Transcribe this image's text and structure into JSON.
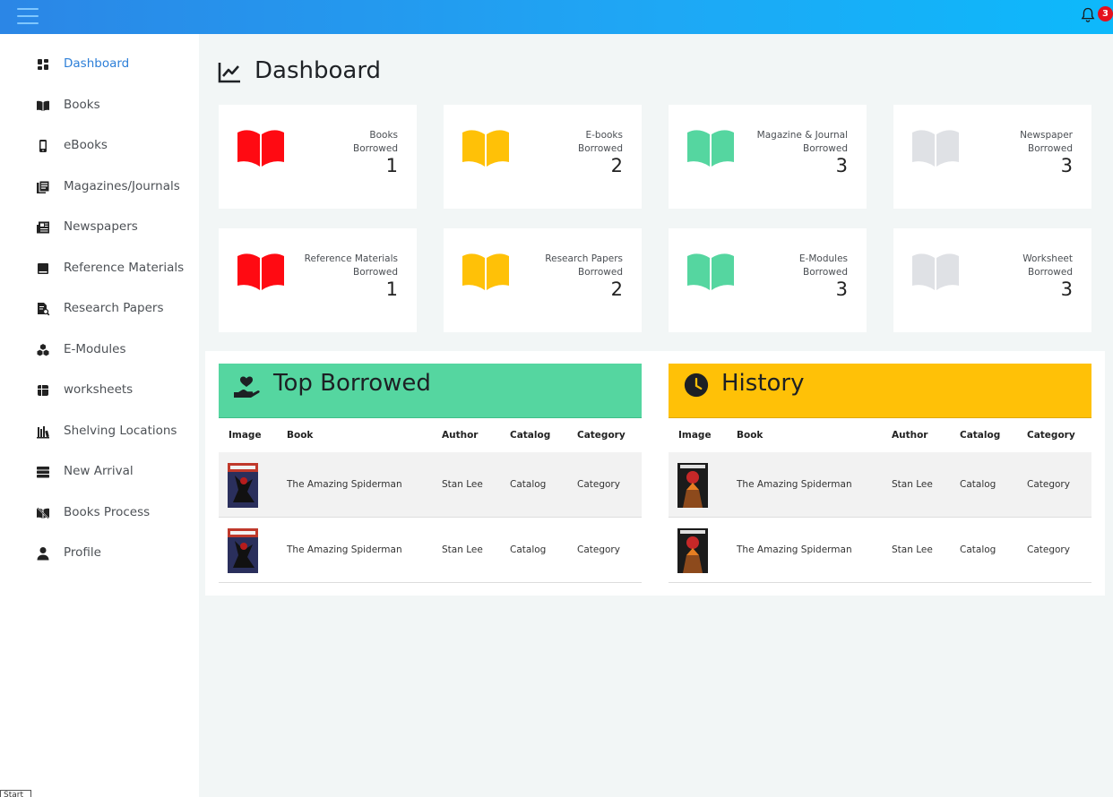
{
  "topbar": {
    "menu_icon": "hamburger-icon",
    "notification_icon": "bell-icon",
    "notification_count": "3",
    "colors": {
      "gradient_start": "#2b86e6",
      "gradient_end": "#0db9fb",
      "badge": "#e5101d"
    }
  },
  "sidebar": {
    "items": [
      {
        "label": "Dashboard",
        "icon": "dashboard-icon",
        "active": true
      },
      {
        "label": "Books",
        "icon": "book-icon",
        "active": false
      },
      {
        "label": "eBooks",
        "icon": "tablet-icon",
        "active": false
      },
      {
        "label": "Magazines/Journals",
        "icon": "magazine-icon",
        "active": false
      },
      {
        "label": "Newspapers",
        "icon": "newspaper-icon",
        "active": false
      },
      {
        "label": "Reference Materials",
        "icon": "reference-book-icon",
        "active": false
      },
      {
        "label": "Research Papers",
        "icon": "research-document-icon",
        "active": false
      },
      {
        "label": "E-Modules",
        "icon": "modules-icon",
        "active": false
      },
      {
        "label": "worksheets",
        "icon": "worksheet-icon",
        "active": false
      },
      {
        "label": "Shelving Locations",
        "icon": "shelf-icon",
        "active": false
      },
      {
        "label": "New Arrival",
        "icon": "stack-icon",
        "active": false
      },
      {
        "label": "Books Process",
        "icon": "book-process-icon",
        "active": false
      },
      {
        "label": "Profile",
        "icon": "user-icon",
        "active": false
      }
    ],
    "active_color": "#2d7fd8"
  },
  "footer_box": "Start",
  "page": {
    "title": "Dashboard",
    "title_icon": "line-chart-icon"
  },
  "cards": [
    {
      "label_line1": "Books",
      "label_line2": "Borrowed",
      "value": "1",
      "color": "#ff0a12"
    },
    {
      "label_line1": "E-books",
      "label_line2": "Borrowed",
      "value": "2",
      "color": "#ffc107"
    },
    {
      "label_line1": "Magazine & Journal",
      "label_line2": "Borrowed",
      "value": "3",
      "color": "#55d6a0"
    },
    {
      "label_line1": "Newspaper",
      "label_line2": "Borrowed",
      "value": "3",
      "color": "#dfe1e5"
    },
    {
      "label_line1": "Reference Materials",
      "label_line2": "Borrowed",
      "value": "1",
      "color": "#ff0a12"
    },
    {
      "label_line1": "Research Papers",
      "label_line2": "Borrowed",
      "value": "2",
      "color": "#ffc107"
    },
    {
      "label_line1": "E-Modules",
      "label_line2": "Borrowed",
      "value": "3",
      "color": "#55d6a0"
    },
    {
      "label_line1": "Worksheet",
      "label_line2": "Borrowed",
      "value": "3",
      "color": "#dfe1e5"
    }
  ],
  "top_borrowed": {
    "title": "Top Borrowed",
    "icon": "hand-heart-icon",
    "color": "#55d6a0",
    "columns": [
      "Image",
      "Book",
      "Author",
      "Catalog",
      "Category"
    ],
    "rows": [
      {
        "image": "comic-cover-thumbnail",
        "book": "The Amazing Spiderman",
        "author": "Stan Lee",
        "catalog": "Catalog",
        "category": "Category"
      },
      {
        "image": "comic-cover-thumbnail",
        "book": "The Amazing Spiderman",
        "author": "Stan Lee",
        "catalog": "Catalog",
        "category": "Category"
      }
    ]
  },
  "history": {
    "title": "History",
    "icon": "clock-icon",
    "color": "#ffc107",
    "columns": [
      "Image",
      "Book",
      "Author",
      "Catalog",
      "Category"
    ],
    "rows": [
      {
        "image": "comic-cover-thumbnail",
        "book": "The Amazing Spiderman",
        "author": "Stan Lee",
        "catalog": "Catalog",
        "category": "Category"
      },
      {
        "image": "comic-cover-thumbnail",
        "book": "The Amazing Spiderman",
        "author": "Stan Lee",
        "catalog": "Catalog",
        "category": "Category"
      }
    ]
  }
}
